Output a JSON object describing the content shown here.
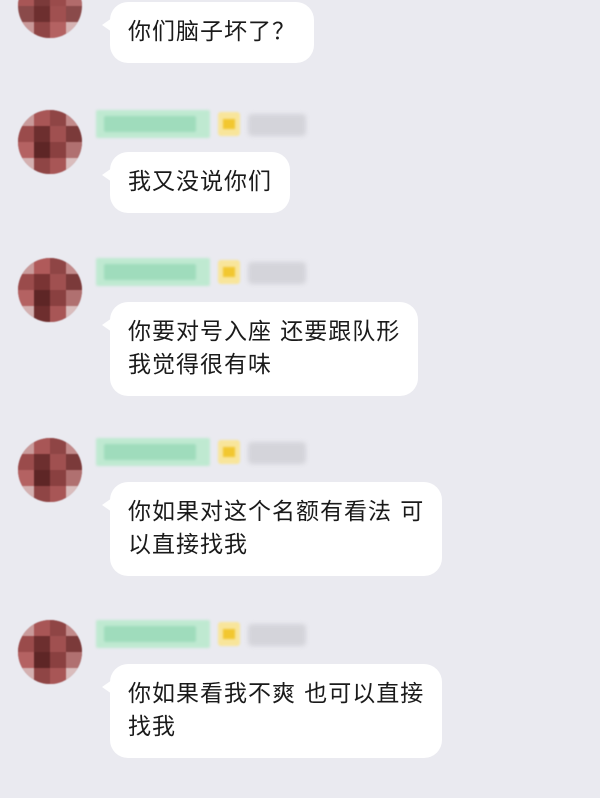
{
  "messages": [
    {
      "text_lines": [
        "你们脑子坏了？"
      ]
    },
    {
      "text_lines": [
        "我又没说你们"
      ]
    },
    {
      "text_lines": [
        "你要对号入座 还要跟队形",
        "我觉得很有味"
      ]
    },
    {
      "text_lines": [
        "你如果对这个名额有看法 可",
        "以直接找我"
      ]
    },
    {
      "text_lines": [
        "你如果看我不爽 也可以直接",
        "找我"
      ]
    }
  ],
  "colors": {
    "background": "#eaeaf0",
    "bubble": "#ffffff",
    "name_blur": "#9fdcbc",
    "badge_yellow": "#f2c730",
    "avatar_red": "#8a4a4a"
  },
  "icons": {
    "avatar": "blurred-avatar-icon",
    "badge": "level-badge-icon"
  }
}
